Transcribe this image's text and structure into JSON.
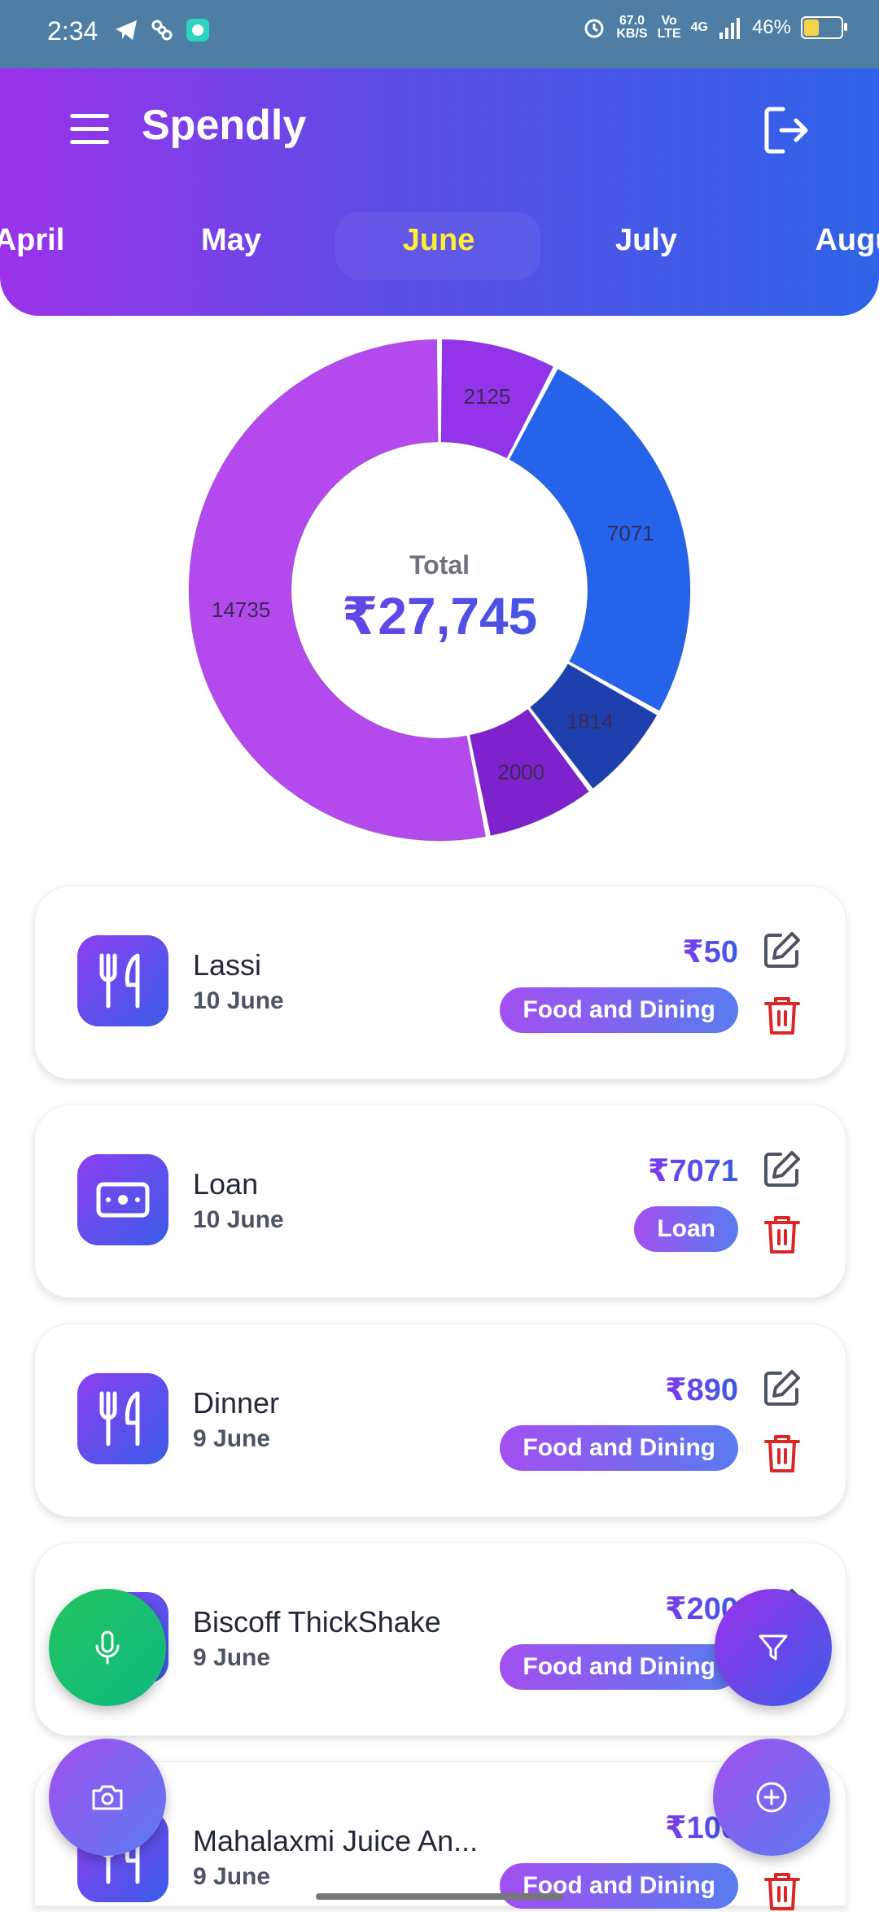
{
  "status_bar": {
    "time": "2:34",
    "net_speed_value": "67.0",
    "net_speed_unit": "KB/S",
    "volte_top": "Vo",
    "volte_bottom": "LTE",
    "network": "4G",
    "battery": "46%",
    "battery_level": 0.46
  },
  "header": {
    "app_title": "Spendly",
    "months": [
      "April",
      "May",
      "June",
      "July",
      "Augu"
    ],
    "selected_month": "June"
  },
  "chart_data": {
    "type": "pie",
    "donut": true,
    "center_label": "Total",
    "center_value": "₹27,745",
    "slices": [
      {
        "label": "2125",
        "value": 2125,
        "color": "#9333ea"
      },
      {
        "label": "7071",
        "value": 7071,
        "color": "#2563eb"
      },
      {
        "label": "1814",
        "value": 1814,
        "color": "#1e40af"
      },
      {
        "label": "2000",
        "value": 2000,
        "color": "#7e22ce"
      },
      {
        "label": "14735",
        "value": 14735,
        "color": "#b44aee"
      }
    ]
  },
  "expenses": [
    {
      "name": "Lassi",
      "date": "10 June",
      "amount": "₹50",
      "category": "Food and Dining",
      "icon": "fork-knife-icon"
    },
    {
      "name": "Loan",
      "date": "10 June",
      "amount": "₹7071",
      "category": "Loan",
      "icon": "cash-icon"
    },
    {
      "name": "Dinner",
      "date": "9 June",
      "amount": "₹890",
      "category": "Food and Dining",
      "icon": "fork-knife-icon"
    },
    {
      "name": "Biscoff ThickShake",
      "date": "9 June",
      "amount": "₹200",
      "category": "Food and Dining",
      "icon": "fork-knife-icon"
    },
    {
      "name": "Mahalaxmi Juice An...",
      "date": "9 June",
      "amount": "₹100",
      "category": "Food and Dining",
      "icon": "fork-knife-icon"
    }
  ],
  "colors": {
    "header_gradient_start": "#9b32ea",
    "header_gradient_end": "#2f63e8",
    "active_month": "#ffee33",
    "delete": "#dc2626",
    "mic_fab": "#22c55e"
  }
}
